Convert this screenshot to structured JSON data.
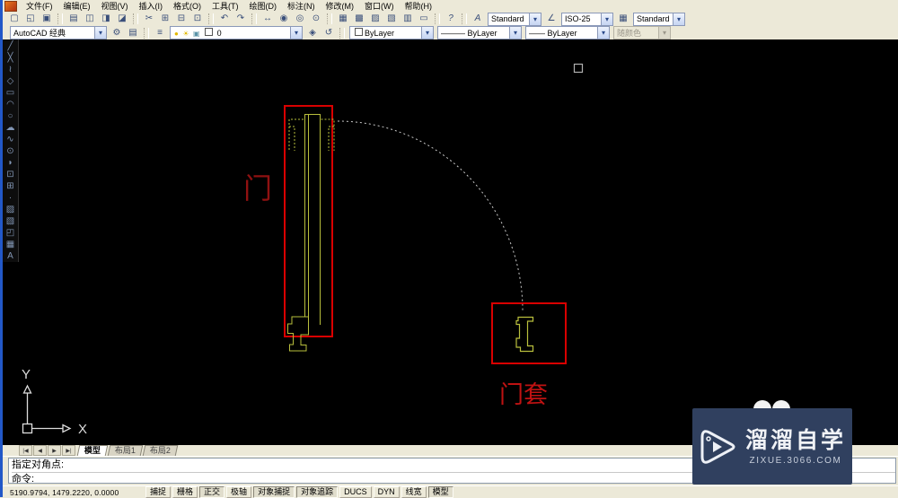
{
  "menu": {
    "items": [
      "文件(F)",
      "编辑(E)",
      "视图(V)",
      "插入(I)",
      "格式(O)",
      "工具(T)",
      "绘图(D)",
      "标注(N)",
      "修改(M)",
      "窗口(W)",
      "帮助(H)"
    ]
  },
  "toolbar_standard": {
    "icons": [
      {
        "name": "new",
        "glyph": "▢"
      },
      {
        "name": "open",
        "glyph": "◱"
      },
      {
        "name": "save",
        "glyph": "▣"
      },
      {
        "name": "plot",
        "glyph": "▤"
      },
      {
        "name": "plot-preview",
        "glyph": "◫"
      },
      {
        "name": "publish",
        "glyph": "◨"
      },
      {
        "name": "etransmit",
        "glyph": "◪"
      },
      {
        "name": "cut",
        "glyph": "✂"
      },
      {
        "name": "copy",
        "glyph": "⊞"
      },
      {
        "name": "paste",
        "glyph": "⊟"
      },
      {
        "name": "match-properties",
        "glyph": "⊡"
      },
      {
        "name": "undo",
        "glyph": "↶"
      },
      {
        "name": "redo",
        "glyph": "↷"
      },
      {
        "name": "pan",
        "glyph": "↔"
      },
      {
        "name": "zoom-realtime",
        "glyph": "◉"
      },
      {
        "name": "zoom-window",
        "glyph": "◎"
      },
      {
        "name": "zoom-previous",
        "glyph": "⊙"
      },
      {
        "name": "properties",
        "glyph": "▦"
      },
      {
        "name": "designcenter",
        "glyph": "▩"
      },
      {
        "name": "tool-palettes",
        "glyph": "▨"
      },
      {
        "name": "sheetset-manager",
        "glyph": "▧"
      },
      {
        "name": "markup",
        "glyph": "▥"
      },
      {
        "name": "quickcalc",
        "glyph": "▭"
      },
      {
        "name": "help",
        "glyph": "?"
      }
    ],
    "text_style_icon": "A",
    "text_style_value": "Standard",
    "dim_style_icon": "∠",
    "dim_style_value": "ISO-25",
    "table_style_icon": "▦",
    "table_style_value": "Standard"
  },
  "toolbar_workspace": {
    "workspace_value": "AutoCAD 经典",
    "settings_glyph": "⚙",
    "save_glyph": "▤"
  },
  "toolbar_layers": {
    "layer_manager_glyph": "≡",
    "bulb_glyph": "●",
    "sun_glyph": "☀",
    "lock_glyph": "▣",
    "layer_name": "0",
    "layer_states_glyph": "◈",
    "layer_previous_glyph": "↺"
  },
  "toolbar_properties": {
    "color_value": "ByLayer",
    "linetype_value": "ByLayer",
    "linetype_glyph": "———",
    "lineweight_value": "ByLayer",
    "lineweight_glyph": "——",
    "plotstyle_value": "随颜色"
  },
  "draw_toolbar": {
    "tools": [
      {
        "name": "line",
        "glyph": "╱"
      },
      {
        "name": "construction-line",
        "glyph": "╳"
      },
      {
        "name": "polyline",
        "glyph": "≀"
      },
      {
        "name": "polygon",
        "glyph": "◇"
      },
      {
        "name": "rectangle",
        "glyph": "▭"
      },
      {
        "name": "arc",
        "glyph": "◠"
      },
      {
        "name": "circle",
        "glyph": "○"
      },
      {
        "name": "revision-cloud",
        "glyph": "☁"
      },
      {
        "name": "spline",
        "glyph": "∿"
      },
      {
        "name": "ellipse",
        "glyph": "⊙"
      },
      {
        "name": "ellipse-arc",
        "glyph": "◗"
      },
      {
        "name": "insert-block",
        "glyph": "⊡"
      },
      {
        "name": "make-block",
        "glyph": "⊞"
      },
      {
        "name": "point",
        "glyph": "·"
      },
      {
        "name": "hatch",
        "glyph": "▨"
      },
      {
        "name": "gradient",
        "glyph": "▧"
      },
      {
        "name": "region",
        "glyph": "◰"
      },
      {
        "name": "table",
        "glyph": "▦"
      },
      {
        "name": "multiline-text",
        "glyph": "A"
      }
    ]
  },
  "canvas": {
    "door_label": "门",
    "frame_label": "门套",
    "ucs_x": "X",
    "ucs_y": "Y",
    "colors": {
      "selection_red": "#d90000",
      "object_green": "#b9bf3c",
      "arc_gray": "#c8c8c8",
      "door_label_red": "#8f1111",
      "frame_label_red": "#bf1212",
      "ucs_white": "#dcdcdc",
      "pickbox_gray": "#b0b0b0",
      "bump_white": "#f2f2f2"
    }
  },
  "layout_tabs": {
    "nav": [
      "|◀",
      "◀",
      "▶",
      "▶|"
    ],
    "tabs": [
      {
        "label": "模型",
        "active": true
      },
      {
        "label": "布局1",
        "active": false
      },
      {
        "label": "布局2",
        "active": false
      }
    ]
  },
  "command": {
    "history_line": "指定对角点:",
    "prompt_line": "命令:"
  },
  "status": {
    "coordinates": "5190.9794, 1479.2220, 0.0000",
    "toggles": [
      {
        "label": "捕捉",
        "pressed": false
      },
      {
        "label": "栅格",
        "pressed": false
      },
      {
        "label": "正交",
        "pressed": true
      },
      {
        "label": "极轴",
        "pressed": false
      },
      {
        "label": "对象捕捉",
        "pressed": true
      },
      {
        "label": "对象追踪",
        "pressed": true
      },
      {
        "label": "DUCS",
        "pressed": false
      },
      {
        "label": "DYN",
        "pressed": false
      },
      {
        "label": "线宽",
        "pressed": false
      },
      {
        "label": "模型",
        "pressed": true
      }
    ]
  },
  "watermark": {
    "title": "溜溜自学",
    "url": "zixue.3066.com"
  }
}
